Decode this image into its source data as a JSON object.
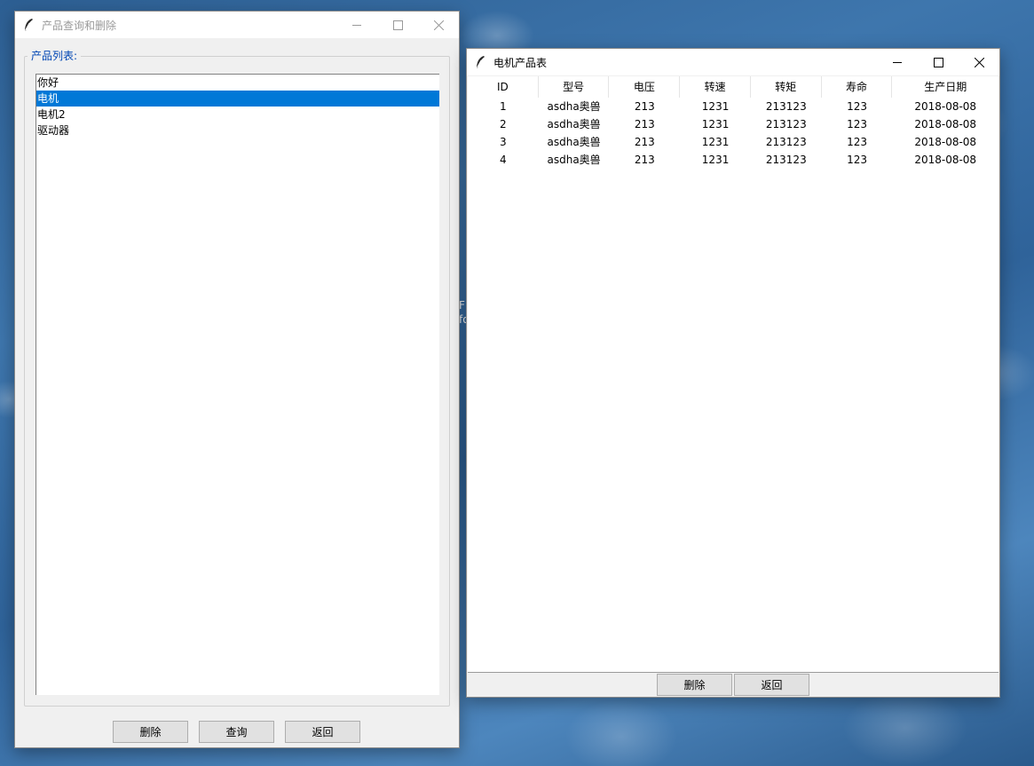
{
  "desktop": {
    "fragment_top": "F",
    "fragment_bottom": "fo"
  },
  "query_window": {
    "title": "产品查询和删除",
    "group_label": "产品列表:",
    "list_items": [
      "你好",
      "电机",
      "电机2",
      "驱动器"
    ],
    "selected_index": 1,
    "buttons": {
      "delete": "删除",
      "query": "查询",
      "back": "返回"
    }
  },
  "table_window": {
    "title": "电机产品表",
    "columns": [
      "ID",
      "型号",
      "电压",
      "转速",
      "转矩",
      "寿命",
      "生产日期"
    ],
    "rows": [
      [
        "1",
        "asdha奥兽",
        "213",
        "1231",
        "213123",
        "123",
        "2018-08-08"
      ],
      [
        "2",
        "asdha奥兽",
        "213",
        "1231",
        "213123",
        "123",
        "2018-08-08"
      ],
      [
        "3",
        "asdha奥兽",
        "213",
        "1231",
        "213123",
        "123",
        "2018-08-08"
      ],
      [
        "4",
        "asdha奥兽",
        "213",
        "1231",
        "213123",
        "123",
        "2018-08-08"
      ]
    ],
    "buttons": {
      "delete": "删除",
      "back": "返回"
    }
  },
  "colors": {
    "selection": "#0078d7",
    "group_label": "#0046b4"
  }
}
